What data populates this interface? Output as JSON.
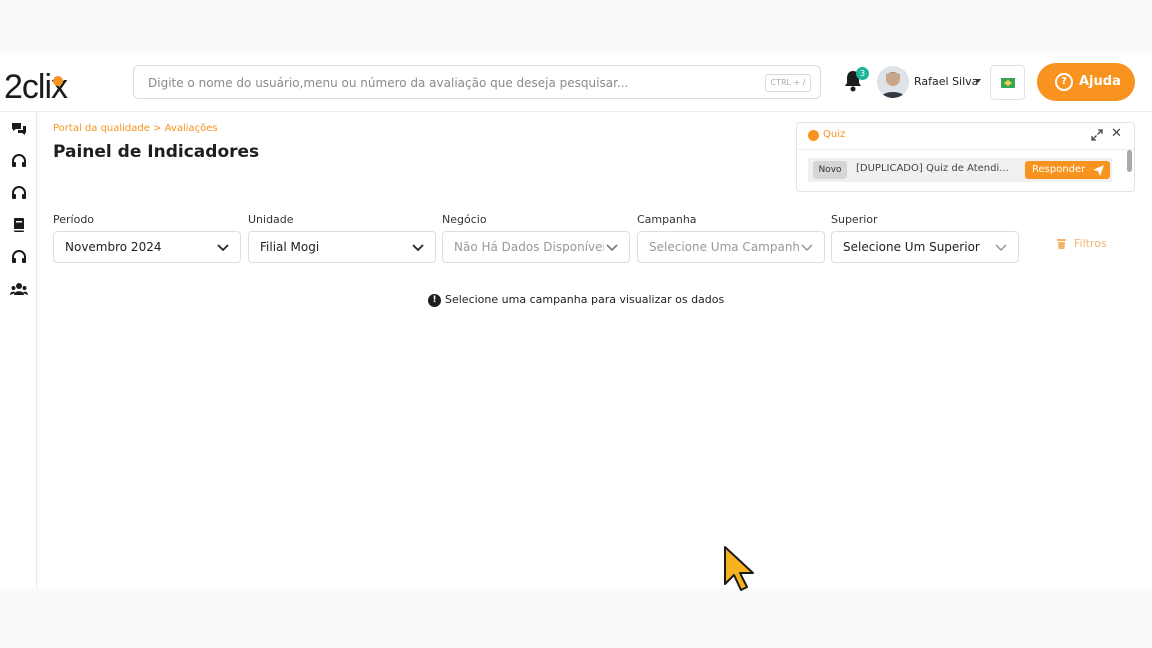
{
  "header": {
    "logo_text": "2clix",
    "search": {
      "placeholder": "Digite o nome do usuário,menu ou número da avaliação que deseja pesquisar...",
      "shortcut": "CTRL + /"
    },
    "notifications": {
      "count": "3"
    },
    "user": {
      "name": "Rafael Silva"
    },
    "help": {
      "label": "Ajuda"
    }
  },
  "sidebar": {
    "items": [
      {
        "icon": "chat-icon"
      },
      {
        "icon": "headset-icon"
      },
      {
        "icon": "headset-icon"
      },
      {
        "icon": "book-icon"
      },
      {
        "icon": "headset-icon"
      },
      {
        "icon": "users-icon"
      }
    ]
  },
  "page": {
    "breadcrumb": "Portal da qualidade > Avaliações",
    "title": "Painel de Indicadores"
  },
  "filters": {
    "periodo": {
      "label": "Período",
      "value": "Novembro 2024"
    },
    "unidade": {
      "label": "Unidade",
      "value": "Filial Mogi"
    },
    "negocio": {
      "label": "Negócio",
      "value": "Não Há Dados Disponíveis"
    },
    "campanha": {
      "label": "Campanha",
      "value": "Selecione Uma Campanha"
    },
    "superior": {
      "label": "Superior",
      "value": "Selecione Um Superior"
    },
    "filtros_label": "Filtros"
  },
  "notice": {
    "text": "Selecione uma campanha para visualizar os dados"
  },
  "quiz": {
    "title": "Quiz",
    "badge": "Novo",
    "item": "[DUPLICADO] Quiz de Atendi...",
    "respond_label": "Responder"
  },
  "colors": {
    "accent": "#f7931e",
    "badge": "#1eb39b"
  }
}
